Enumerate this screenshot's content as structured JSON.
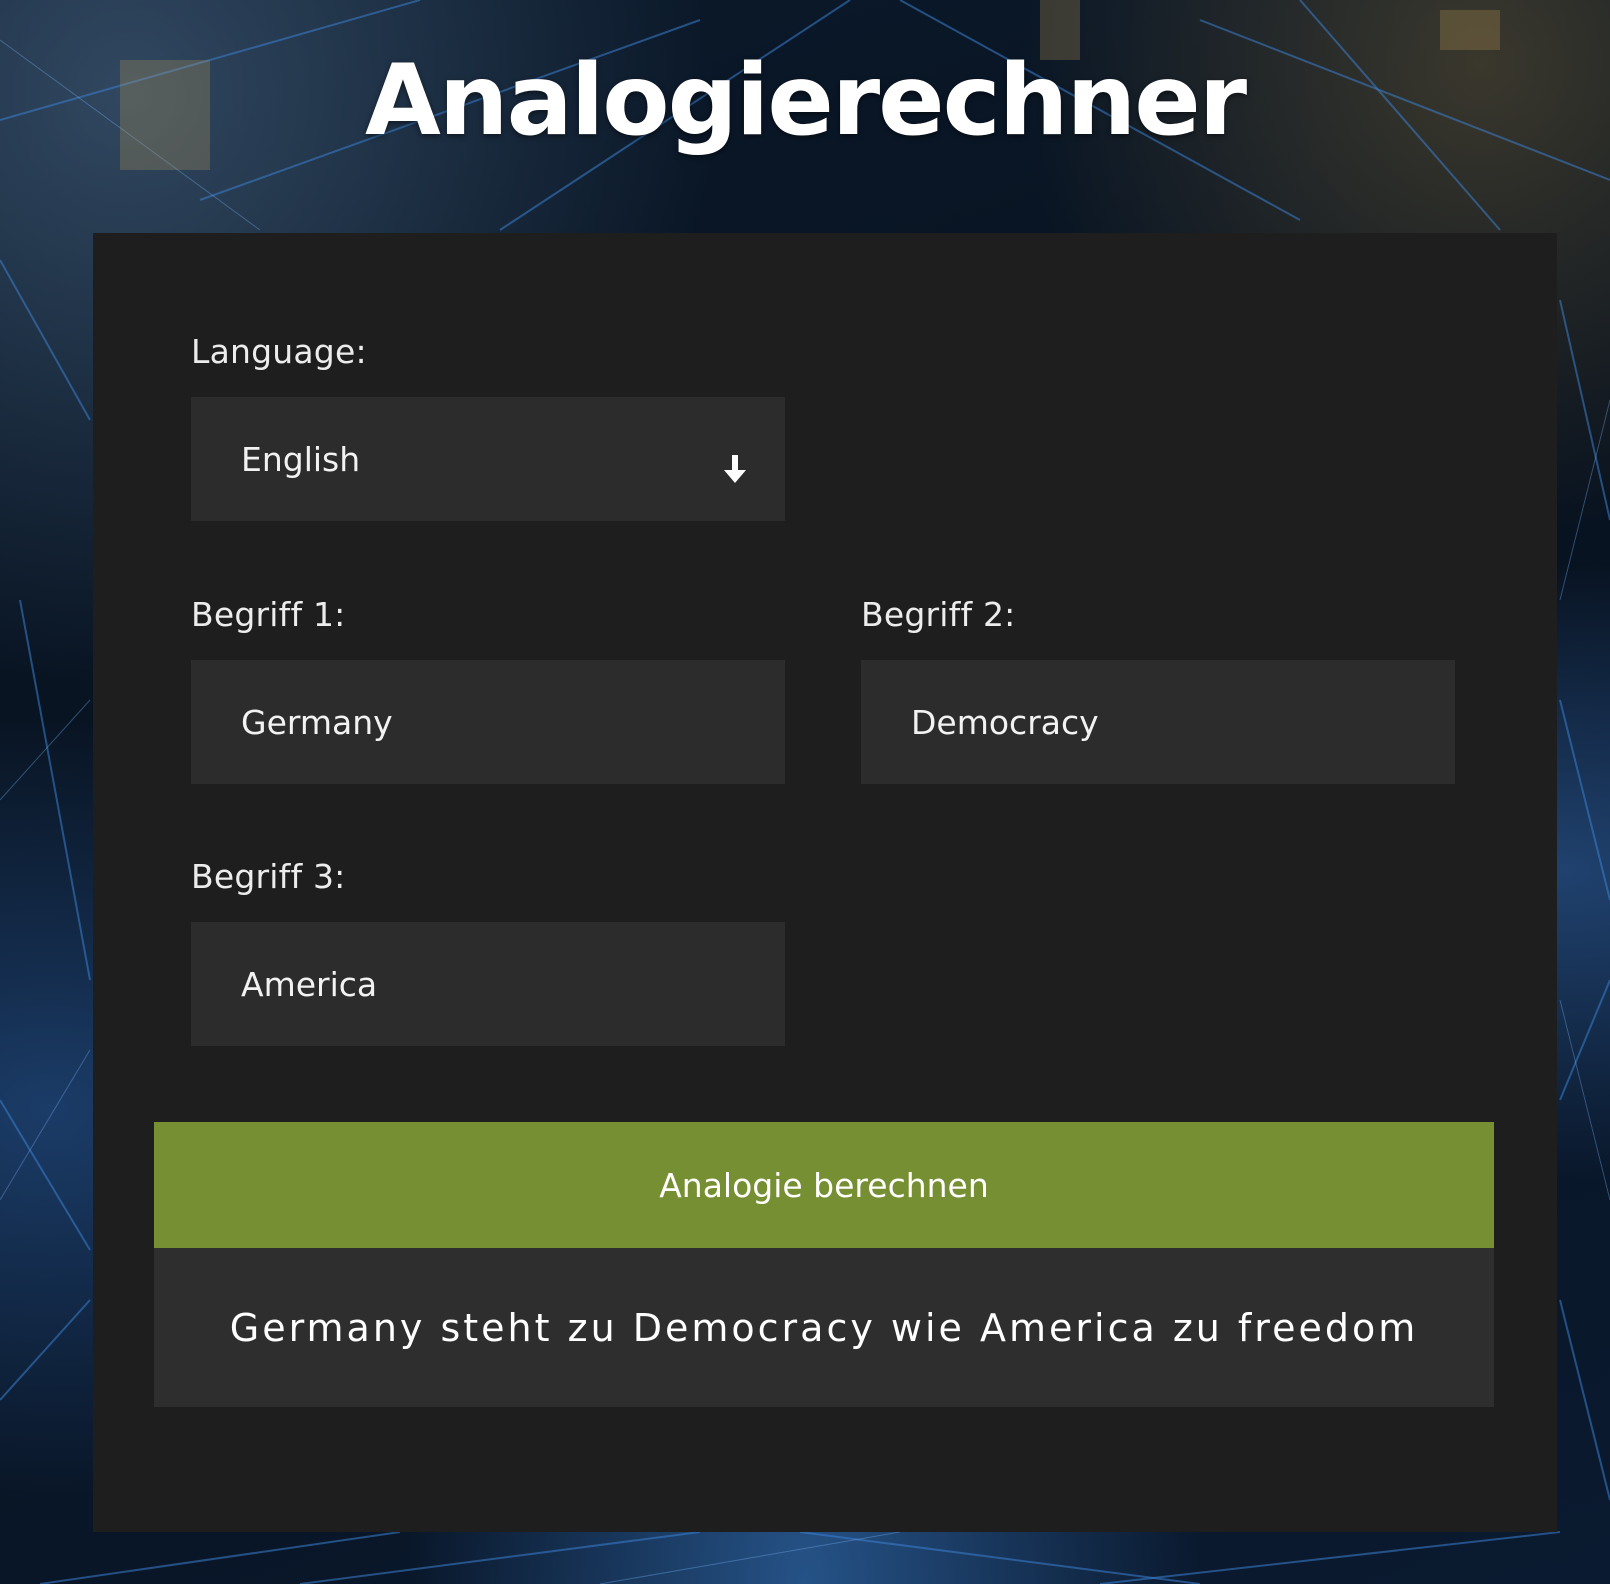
{
  "page": {
    "title": "Analogierechner"
  },
  "form": {
    "language": {
      "label": "Language:",
      "value": "English",
      "icon": "arrow-down-icon"
    },
    "term1": {
      "label": "Begriff 1:",
      "value": "Germany"
    },
    "term2": {
      "label": "Begriff 2:",
      "value": "Democracy"
    },
    "term3": {
      "label": "Begriff 3:",
      "value": "America"
    },
    "submit_label": "Analogie berechnen",
    "result_text": "Germany steht zu Democracy wie America zu freedom"
  },
  "colors": {
    "panel": "#1e1e1e",
    "field": "#2c2c2c",
    "button": "#758f32",
    "result": "#2e2e2e",
    "text": "#ffffff"
  }
}
